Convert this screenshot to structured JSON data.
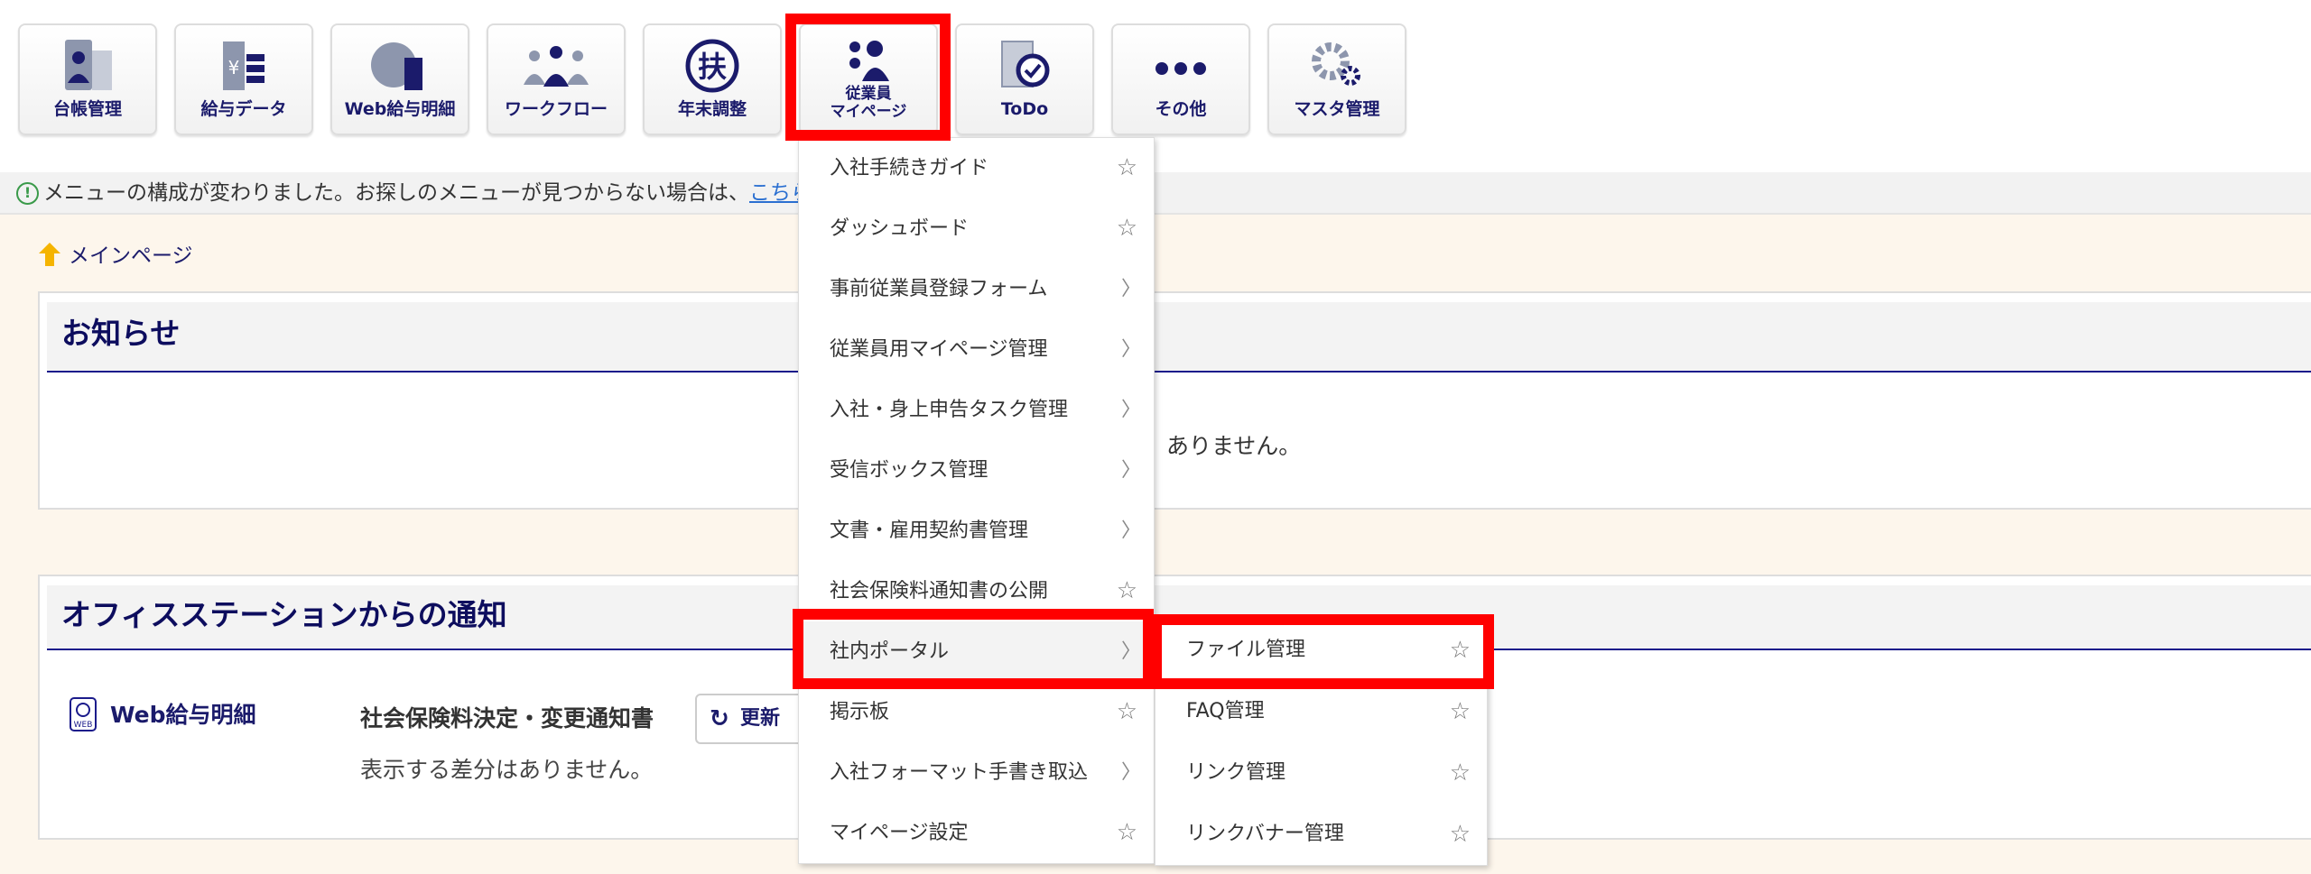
{
  "toolbar": [
    {
      "label": "台帳管理",
      "icon": "ledger-icon"
    },
    {
      "label": "給与データ",
      "icon": "payroll-data-icon"
    },
    {
      "label": "Web給与明細",
      "icon": "web-payslip-icon"
    },
    {
      "label": "ワークフロー",
      "icon": "workflow-icon"
    },
    {
      "label": "年末調整",
      "icon": "year-end-adjustment-icon"
    },
    {
      "label1": "従業員",
      "label2": "マイページ",
      "icon": "employee-mypage-icon"
    },
    {
      "label": "ToDo",
      "icon": "todo-icon"
    },
    {
      "label": "その他",
      "icon": "more-icon"
    },
    {
      "label": "マスタ管理",
      "icon": "master-settings-icon"
    }
  ],
  "notice": {
    "text": "メニューの構成が変わりました。お探しのメニューが見つからない場合は、",
    "link": "こちら"
  },
  "breadcrumb": "メインページ",
  "news": {
    "title": "お知らせ",
    "empty": "ありません。"
  },
  "office": {
    "title": "オフィスステーションからの通知",
    "service": "Web給与明細",
    "doc": "社会保険料決定・変更通知書",
    "refresh": "更新",
    "diff": "表示する差分はありません。"
  },
  "menu": [
    {
      "label": "入社手続きガイド",
      "type": "star"
    },
    {
      "label": "ダッシュボード",
      "type": "star"
    },
    {
      "label": "事前従業員登録フォーム",
      "type": "chevron"
    },
    {
      "label": "従業員用マイページ管理",
      "type": "chevron"
    },
    {
      "label": "入社・身上申告タスク管理",
      "type": "chevron"
    },
    {
      "label": "受信ボックス管理",
      "type": "chevron"
    },
    {
      "label": "文書・雇用契約書管理",
      "type": "chevron"
    },
    {
      "label": "社会保険料通知書の公開",
      "type": "star"
    },
    {
      "label": "社内ポータル",
      "type": "chevron",
      "active": true
    },
    {
      "label": "掲示板",
      "type": "star"
    },
    {
      "label": "入社フォーマット手書き取込",
      "type": "chevron"
    },
    {
      "label": "マイページ設定",
      "type": "star"
    }
  ],
  "submenu": [
    {
      "label": "ファイル管理"
    },
    {
      "label": "FAQ管理"
    },
    {
      "label": "リンク管理"
    },
    {
      "label": "リンクバナー管理"
    }
  ],
  "colors": {
    "navy": "#1b1b6b",
    "highlight": "#ff0000",
    "background": "#fdf6ec"
  }
}
